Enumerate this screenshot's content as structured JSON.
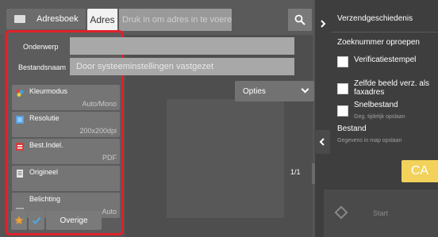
{
  "address_bar": {
    "addressbook_label": "Adresboek",
    "address_tab_label": "Adres",
    "address_placeholder": "Druk in om adres in te voeren",
    "search_icon": "search-icon"
  },
  "fields": {
    "subject_label": "Onderwerp",
    "subject_value": "",
    "filename_label": "Bestandsnaam",
    "filename_value": "Door systeeminstellingen vastgezet"
  },
  "settings": [
    {
      "title": "Kleurmodus",
      "value": "Auto/Mono",
      "icon": "color-mode-icon"
    },
    {
      "title": "Resolutie",
      "value": "200x200dpi",
      "icon": "resolution-icon"
    },
    {
      "title": "Best.Indel.",
      "value": "PDF",
      "icon": "file-format-icon"
    },
    {
      "title": "Origineel",
      "value": "",
      "icon": "original-icon"
    },
    {
      "title": "Belichting",
      "value": "Auto",
      "icon": "exposure-icon"
    }
  ],
  "bottom_buttons": {
    "favorite_icon": "star-icon",
    "check_icon": "check-icon",
    "other_label": "Overige"
  },
  "preview": {
    "options_label": "Opties",
    "page_counter": "1/1"
  },
  "right_panel": {
    "send_history_label": "Verzendgeschiedenis",
    "recall_number_label": "Zoeknummer oproepen",
    "verification_stamp_label": "Verificatiestempel",
    "same_image_label": "Zelfde beeld verz. als faxadres",
    "quick_file_label": "Snelbestand",
    "quick_file_sub": "Geg. tijdelijk opslaan",
    "file_label": "Bestand",
    "file_sub": "Gegevens in map opslaan",
    "ca_label": "CA",
    "start_label": "Start"
  },
  "colors": {
    "highlight_border": "#e0202a",
    "ca_button": "#f2d25a",
    "favorite_star": "#f0a030",
    "check": "#4aa8e8"
  }
}
